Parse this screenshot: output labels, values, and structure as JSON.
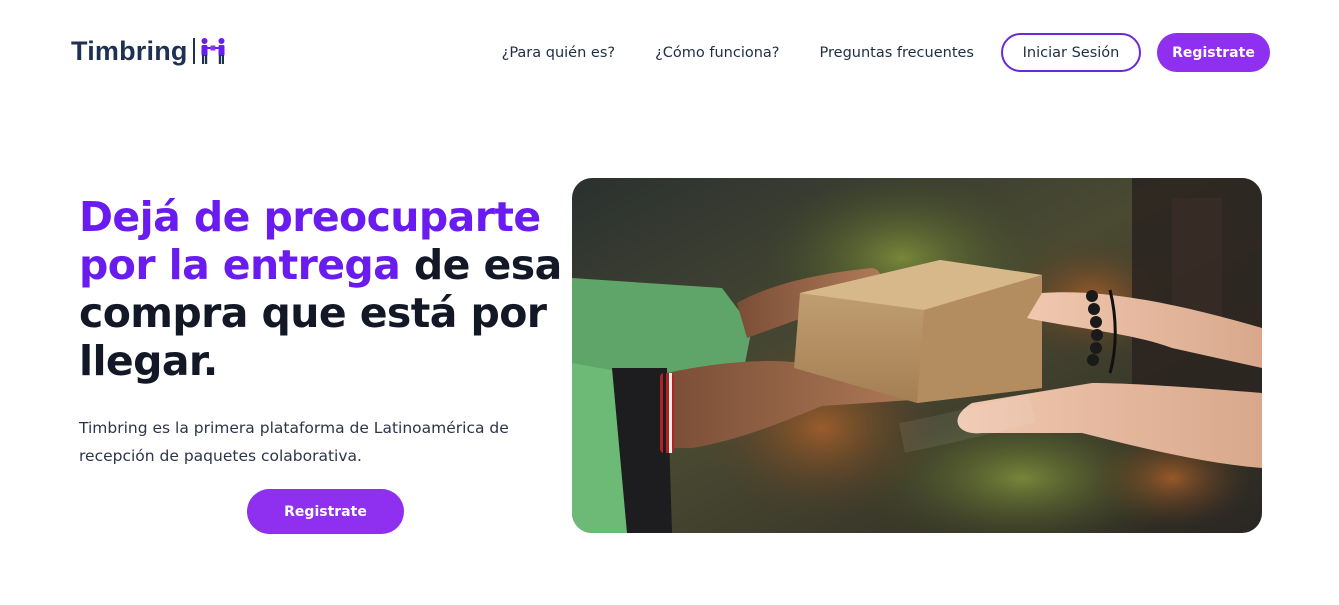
{
  "brand": {
    "name": "Timbring",
    "logo_icon": "handshake-people-icon",
    "color_primary": "#8f2ff0",
    "color_accent_text": "#6a1cf0",
    "color_dark": "#1f3152"
  },
  "nav": {
    "links": [
      {
        "label": "¿Para quién es?"
      },
      {
        "label": "¿Cómo funciona?"
      },
      {
        "label": "Preguntas frecuentes"
      }
    ],
    "login_label": "Iniciar Sesión",
    "register_label": "Registrate"
  },
  "hero": {
    "title_accent": "Dejá de preocuparte por la entrega",
    "title_rest": " de esa compra que está por llegar.",
    "description": "Timbring es la primera plataforma de Latinoamérica de recepción de paquetes colaborativa.",
    "cta_label": "Registrate",
    "image_subject": "hands-passing-cardboard-box-photo"
  }
}
